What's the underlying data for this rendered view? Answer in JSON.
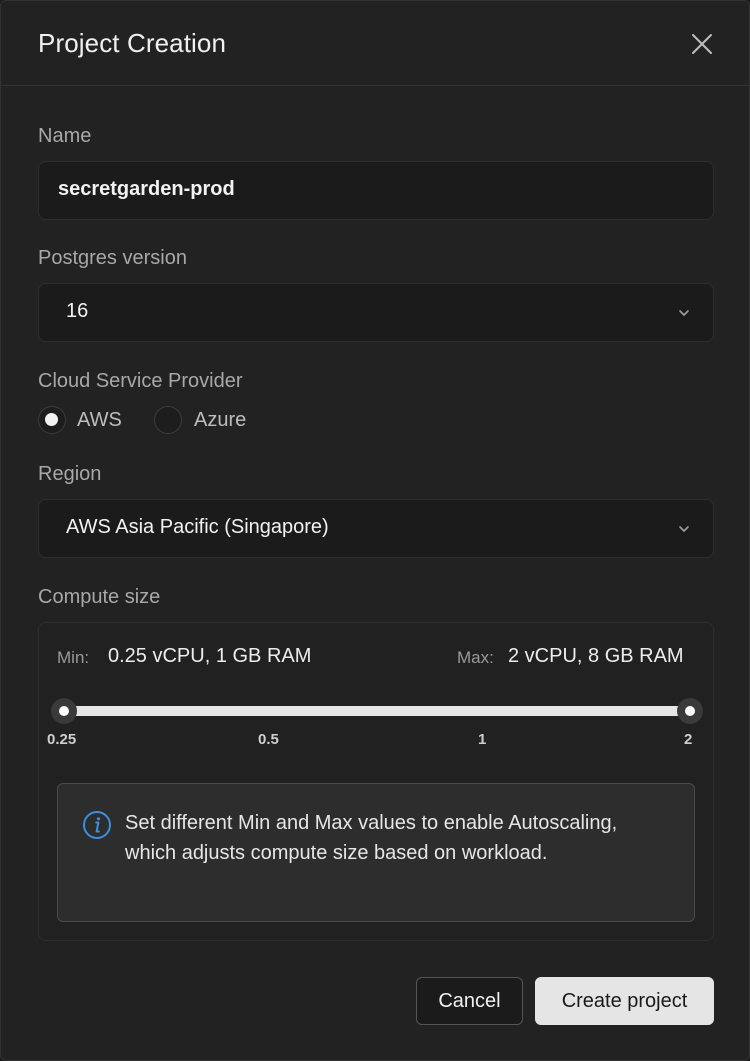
{
  "dialog": {
    "title": "Project Creation"
  },
  "name_field": {
    "label": "Name",
    "value": "secretgarden-prod"
  },
  "postgres_version": {
    "label": "Postgres version",
    "selected": "16"
  },
  "cloud_provider": {
    "label": "Cloud Service Provider",
    "options": [
      {
        "label": "AWS",
        "checked": true
      },
      {
        "label": "Azure",
        "checked": false
      }
    ]
  },
  "region": {
    "label": "Region",
    "selected": "AWS Asia Pacific (Singapore)"
  },
  "compute": {
    "label": "Compute size",
    "min_label": "Min:",
    "min_value": "0.25 vCPU, 1 GB RAM",
    "max_label": "Max:",
    "max_value": "2 vCPU, 8 GB RAM",
    "ticks": [
      "0.25",
      "0.5",
      "1",
      "2"
    ],
    "slider_min": "0.25",
    "slider_max": "2",
    "info": "Set different Min and Max values to enable Autoscaling, which adjusts compute size based on workload."
  },
  "actions": {
    "cancel": "Cancel",
    "create": "Create project"
  },
  "icons": {
    "close": "close-icon",
    "chevron": "chevron-down-icon",
    "info": "info-icon"
  },
  "colors": {
    "info_accent": "#3b8fe0",
    "background": "#222222"
  }
}
